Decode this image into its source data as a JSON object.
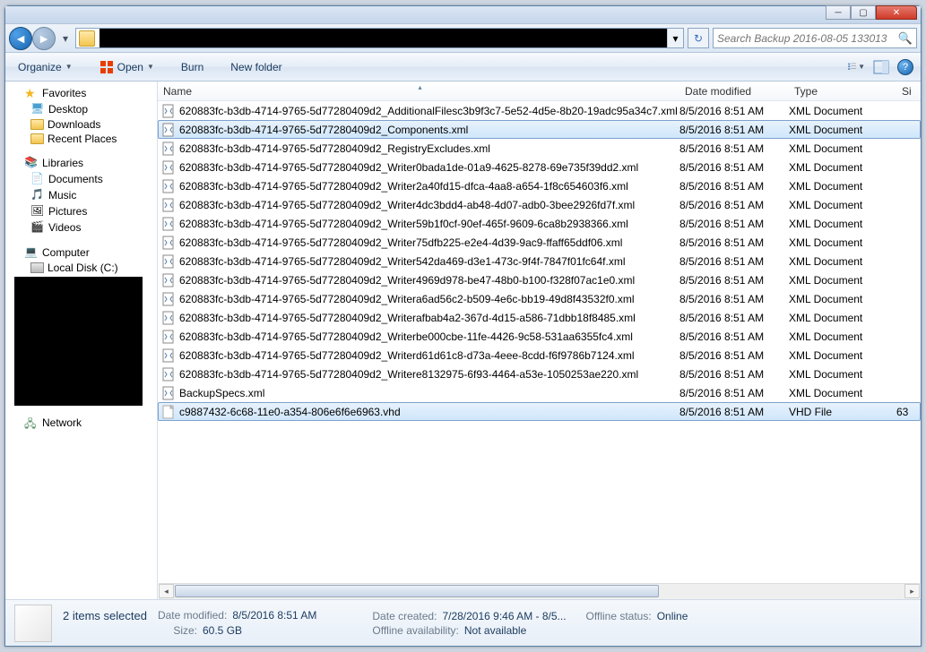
{
  "window": {
    "search_placeholder": "Search Backup 2016-08-05 133013"
  },
  "toolbar": {
    "organize": "Organize",
    "open": "Open",
    "burn": "Burn",
    "new_folder": "New folder"
  },
  "sidebar": {
    "favorites": {
      "label": "Favorites",
      "items": [
        "Desktop",
        "Downloads",
        "Recent Places"
      ]
    },
    "libraries": {
      "label": "Libraries",
      "items": [
        "Documents",
        "Music",
        "Pictures",
        "Videos"
      ]
    },
    "computer": {
      "label": "Computer",
      "items": [
        "Local Disk (C:)"
      ]
    },
    "network": {
      "label": "Network"
    }
  },
  "columns": {
    "name": "Name",
    "date": "Date modified",
    "type": "Type",
    "size": "Si"
  },
  "files": [
    {
      "name": "620883fc-b3db-4714-9765-5d77280409d2_AdditionalFilesc3b9f3c7-5e52-4d5e-8b20-19adc95a34c7.xml",
      "date": "8/5/2016 8:51 AM",
      "type": "XML Document",
      "icon": "xml",
      "sel": false
    },
    {
      "name": "620883fc-b3db-4714-9765-5d77280409d2_Components.xml",
      "date": "8/5/2016 8:51 AM",
      "type": "XML Document",
      "icon": "xml",
      "sel": true
    },
    {
      "name": "620883fc-b3db-4714-9765-5d77280409d2_RegistryExcludes.xml",
      "date": "8/5/2016 8:51 AM",
      "type": "XML Document",
      "icon": "xml",
      "sel": false
    },
    {
      "name": "620883fc-b3db-4714-9765-5d77280409d2_Writer0bada1de-01a9-4625-8278-69e735f39dd2.xml",
      "date": "8/5/2016 8:51 AM",
      "type": "XML Document",
      "icon": "xml",
      "sel": false
    },
    {
      "name": "620883fc-b3db-4714-9765-5d77280409d2_Writer2a40fd15-dfca-4aa8-a654-1f8c654603f6.xml",
      "date": "8/5/2016 8:51 AM",
      "type": "XML Document",
      "icon": "xml",
      "sel": false
    },
    {
      "name": "620883fc-b3db-4714-9765-5d77280409d2_Writer4dc3bdd4-ab48-4d07-adb0-3bee2926fd7f.xml",
      "date": "8/5/2016 8:51 AM",
      "type": "XML Document",
      "icon": "xml",
      "sel": false
    },
    {
      "name": "620883fc-b3db-4714-9765-5d77280409d2_Writer59b1f0cf-90ef-465f-9609-6ca8b2938366.xml",
      "date": "8/5/2016 8:51 AM",
      "type": "XML Document",
      "icon": "xml",
      "sel": false
    },
    {
      "name": "620883fc-b3db-4714-9765-5d77280409d2_Writer75dfb225-e2e4-4d39-9ac9-ffaff65ddf06.xml",
      "date": "8/5/2016 8:51 AM",
      "type": "XML Document",
      "icon": "xml",
      "sel": false
    },
    {
      "name": "620883fc-b3db-4714-9765-5d77280409d2_Writer542da469-d3e1-473c-9f4f-7847f01fc64f.xml",
      "date": "8/5/2016 8:51 AM",
      "type": "XML Document",
      "icon": "xml",
      "sel": false
    },
    {
      "name": "620883fc-b3db-4714-9765-5d77280409d2_Writer4969d978-be47-48b0-b100-f328f07ac1e0.xml",
      "date": "8/5/2016 8:51 AM",
      "type": "XML Document",
      "icon": "xml",
      "sel": false
    },
    {
      "name": "620883fc-b3db-4714-9765-5d77280409d2_Writera6ad56c2-b509-4e6c-bb19-49d8f43532f0.xml",
      "date": "8/5/2016 8:51 AM",
      "type": "XML Document",
      "icon": "xml",
      "sel": false
    },
    {
      "name": "620883fc-b3db-4714-9765-5d77280409d2_Writerafbab4a2-367d-4d15-a586-71dbb18f8485.xml",
      "date": "8/5/2016 8:51 AM",
      "type": "XML Document",
      "icon": "xml",
      "sel": false
    },
    {
      "name": "620883fc-b3db-4714-9765-5d77280409d2_Writerbe000cbe-11fe-4426-9c58-531aa6355fc4.xml",
      "date": "8/5/2016 8:51 AM",
      "type": "XML Document",
      "icon": "xml",
      "sel": false
    },
    {
      "name": "620883fc-b3db-4714-9765-5d77280409d2_Writerd61d61c8-d73a-4eee-8cdd-f6f9786b7124.xml",
      "date": "8/5/2016 8:51 AM",
      "type": "XML Document",
      "icon": "xml",
      "sel": false
    },
    {
      "name": "620883fc-b3db-4714-9765-5d77280409d2_Writere8132975-6f93-4464-a53e-1050253ae220.xml",
      "date": "8/5/2016 8:51 AM",
      "type": "XML Document",
      "icon": "xml",
      "sel": false
    },
    {
      "name": "BackupSpecs.xml",
      "date": "8/5/2016 8:51 AM",
      "type": "XML Document",
      "icon": "xml",
      "sel": false
    },
    {
      "name": "c9887432-6c68-11e0-a354-806e6f6e6963.vhd",
      "date": "8/5/2016 8:51 AM",
      "type": "VHD File",
      "icon": "vhd",
      "sel": true,
      "sizecol": "63"
    }
  ],
  "status": {
    "title": "2 items selected",
    "date_mod_label": "Date modified:",
    "date_mod": "8/5/2016 8:51 AM",
    "size_label": "Size:",
    "size": "60.5 GB",
    "date_created_label": "Date created:",
    "date_created": "7/28/2016 9:46 AM - 8/5...",
    "offline_avail_label": "Offline availability:",
    "offline_avail": "Not available",
    "offline_status_label": "Offline status:",
    "offline_status": "Online"
  }
}
